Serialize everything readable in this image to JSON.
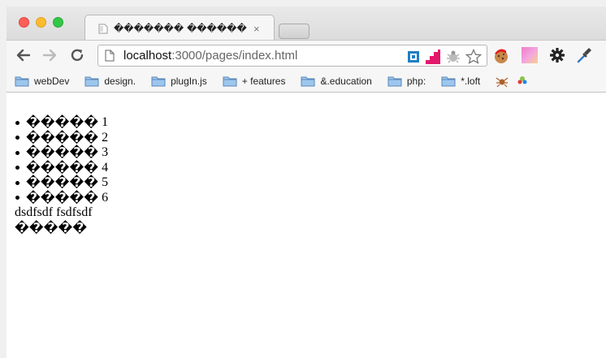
{
  "tab": {
    "title": "������� ������",
    "close_glyph": "×"
  },
  "toolbar": {
    "url_host": "localhost",
    "url_rest": ":3000/pages/index.html"
  },
  "bookmarks": [
    {
      "label": "webDev"
    },
    {
      "label": "design."
    },
    {
      "label": "plugIn.js"
    },
    {
      "label": "+ features"
    },
    {
      "label": "&.education"
    },
    {
      "label": "php:"
    },
    {
      "label": "*.loft"
    }
  ],
  "content": {
    "list": [
      {
        "glyphs": "�����",
        "num": "1"
      },
      {
        "glyphs": "�����",
        "num": "2"
      },
      {
        "glyphs": "�����",
        "num": "3"
      },
      {
        "glyphs": "�����",
        "num": "4"
      },
      {
        "glyphs": "�����",
        "num": "5"
      },
      {
        "glyphs": "�����",
        "num": "6"
      }
    ],
    "text_line": "dsdfsdf fsdfsdf",
    "glyph_line": "�����"
  },
  "colors": {
    "close": "#fc5f57",
    "minimize": "#fdbc2e",
    "maximize": "#33c748"
  }
}
